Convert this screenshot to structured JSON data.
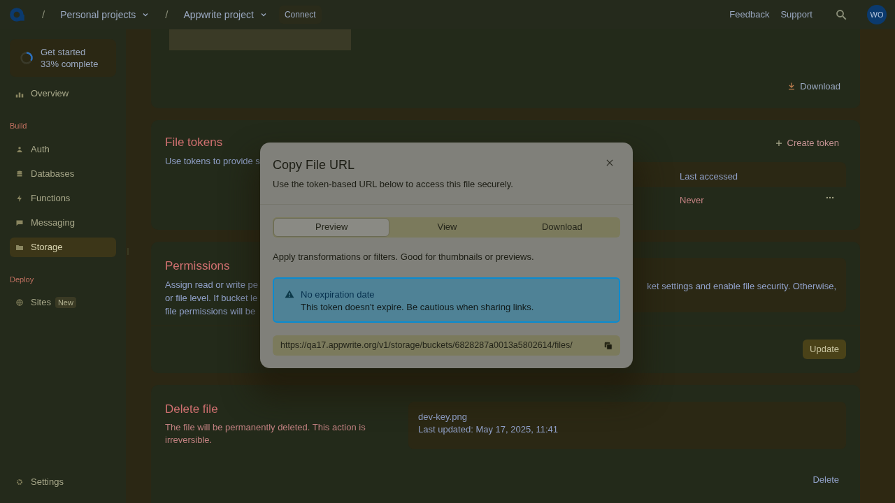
{
  "header": {
    "breadcrumbs": [
      {
        "separator": "/",
        "label": "Personal projects"
      },
      {
        "separator": "/",
        "label": "Appwrite project"
      }
    ],
    "connect_button": "Connect",
    "links": [
      "Feedback",
      "Support"
    ],
    "avatar": "WO"
  },
  "sidebar": {
    "progress": {
      "title": "Get started",
      "subtitle": "33% complete",
      "level": 0.33
    },
    "overview": {
      "label": "Overview",
      "selected": false
    },
    "sections": [
      {
        "title": "Build",
        "items": [
          {
            "label": "Auth",
            "selected": false
          },
          {
            "label": "Databases",
            "selected": false
          },
          {
            "label": "Functions",
            "selected": false
          },
          {
            "label": "Messaging",
            "selected": false
          },
          {
            "label": "Storage",
            "selected": true
          }
        ]
      },
      {
        "title": "Deploy",
        "items": [
          {
            "label": "Sites",
            "badge": "New",
            "selected": false
          }
        ]
      }
    ],
    "settings": {
      "label": "Settings",
      "selected": false
    }
  },
  "main": {
    "preview_card": {
      "download_button": "Download"
    },
    "file_tokens": {
      "title": "File tokens",
      "description": "Use tokens to provide s",
      "create_button": "Create token",
      "column": "Last accessed",
      "row_value": "Never"
    },
    "permissions": {
      "title": "Permissions",
      "description_lines": [
        "Assign read or write pe",
        "or file level. If bucket le",
        "file permissions will be"
      ],
      "right_note": "ket settings and enable file security. Otherwise,",
      "update_button": "Update"
    },
    "delete_file": {
      "title": "Delete file",
      "description": "The file will be permanently deleted. This action is irreversible.",
      "file_name": "dev-key.png",
      "last_updated": "Last updated: May 17, 2025, 11:41",
      "delete_button": "Delete"
    }
  },
  "modal": {
    "title": "Copy File URL",
    "subtitle": "Use the token-based URL below to access this file securely.",
    "tabs": [
      {
        "label": "Preview",
        "selected": true
      },
      {
        "label": "View",
        "selected": false
      },
      {
        "label": "Download",
        "selected": false
      }
    ],
    "description": "Apply transformations or filters. Good for thumbnails or previews.",
    "alert": {
      "title": "No expiration date",
      "message": "This token doesn't expire. Be cautious when sharing links."
    },
    "url": "https://qa17.appwrite.org/v1/storage/buckets/6828287a0013a5802614/files/"
  }
}
